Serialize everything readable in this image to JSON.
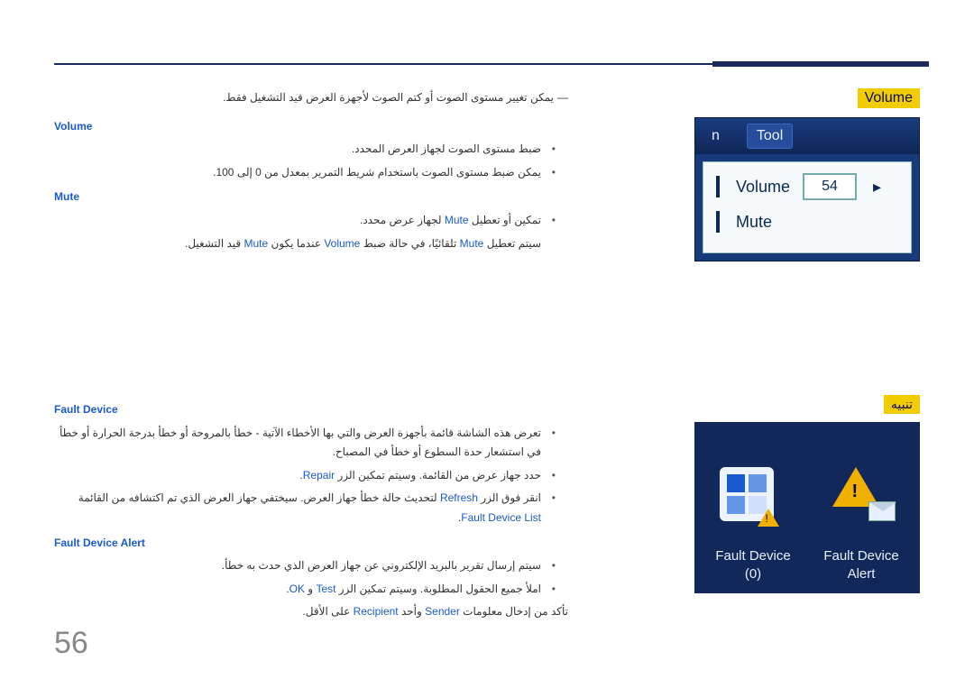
{
  "page_number": "56",
  "labels": {
    "volume": "Volume",
    "alert": "تنبيه"
  },
  "shot_volume": {
    "tab_n": "n",
    "tab_tool": "Tool",
    "row_volume": "Volume",
    "value": "54",
    "arrow": "▸",
    "row_mute": "Mute"
  },
  "shot_alert": {
    "col1_line1": "Fault Device",
    "col1_line2": "(0)",
    "col2_line1": "Fault Device",
    "col2_line2": "Alert"
  },
  "text": {
    "intro": "يمكن تغيير مستوى الصوت أو كتم الصوت لأجهزة العرض قيد التشغيل فقط.",
    "h_volume": "Volume",
    "vol_li1": "ضبط مستوى الصوت لجهاز العرض المحدد.",
    "vol_li2": "يمكن ضبط مستوى الصوت باستخدام شريط التمرير بمعدل من 0 إلى 100.",
    "h_mute": "Mute",
    "mute_li1_a": "تمكين أو تعطيل ",
    "mute_li1_b": " لجهاز عرض محدد.",
    "mute_note_a": "سيتم تعطيل ",
    "mute_note_b": " تلقائيًا، في حالة ضبط ",
    "mute_note_c": " عندما يكون ",
    "mute_note_d": " قيد التشغيل.",
    "word_mute": "Mute",
    "word_volume": "Volume",
    "h_fd": "Fault Device",
    "fd_li1": "تعرض هذه الشاشة قائمة بأجهزة العرض والتي بها الأخطاء الآتية - خطأ بالمروحة أو خطأ بدرجة الحرارة أو خطأ في استشعار حدة السطوع أو خطأ في المصباح.",
    "fd_li2_a": "حدد جهاز عرض من القائمة. وسيتم تمكين الزر ",
    "fd_li2_b": ".",
    "word_repair": "Repair",
    "fd_li3_a": "انقر فوق الزر ",
    "fd_li3_b": " لتحديث حالة خطأ جهاز العرض. سيختفي جهاز العرض الذي تم اكتشافه من القائمة ",
    "fd_li3_c": ".",
    "word_refresh": "Refresh",
    "word_fdl": "Fault Device List",
    "h_fda": "Fault Device Alert",
    "fda_li1": "سيتم إرسال تقرير بالبريد الإلكتروني عن جهاز العرض الذي حدث به خطأ.",
    "fda_li2_a": "املأ جميع الحقول المطلوبة. وسيتم تمكين الزر ",
    "fda_li2_b": " و ",
    "fda_li2_c": ".",
    "word_test": "Test",
    "word_ok": "OK",
    "fda_note_a": "تأكد من إدخال معلومات ",
    "fda_note_b": " وأحد ",
    "fda_note_c": " على الأقل.",
    "word_sender": "Sender",
    "word_recipient": "Recipient"
  }
}
